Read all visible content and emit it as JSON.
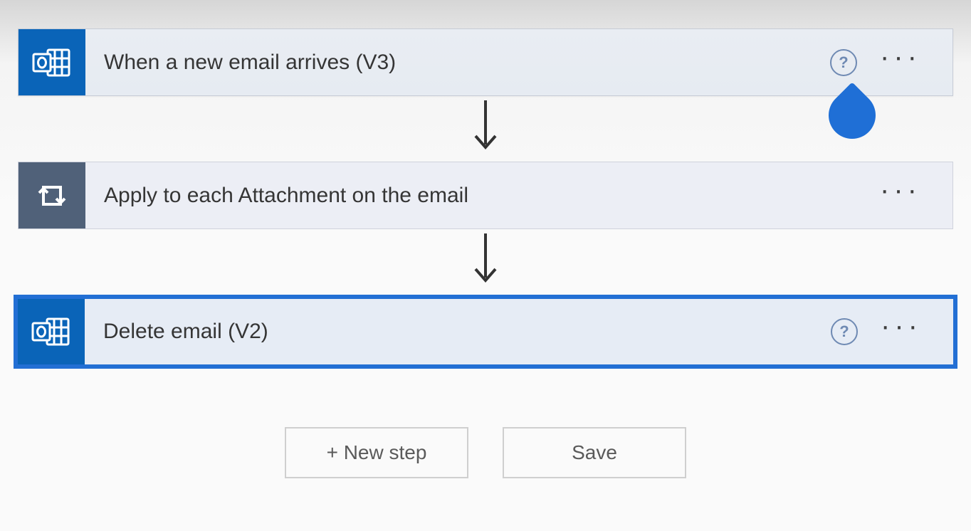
{
  "flow": {
    "trigger": {
      "title": "When a new email arrives (V3)",
      "icon": "outlook-icon",
      "help_visible": true
    },
    "action1": {
      "title": "Apply to each Attachment on the email",
      "icon": "loop-icon"
    },
    "action2": {
      "title": "Delete email (V2)",
      "icon": "outlook-icon",
      "help_visible": true,
      "selected": true
    }
  },
  "buttons": {
    "new_step": "+ New step",
    "save": "Save"
  },
  "glyphs": {
    "help": "?",
    "more": "···"
  }
}
